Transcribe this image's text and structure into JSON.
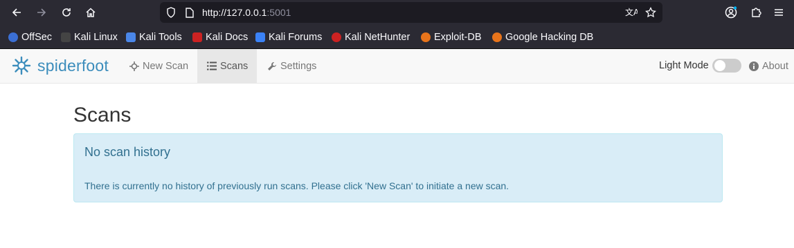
{
  "browser": {
    "url_host": "http://127.0.0.1",
    "url_port": ":5001",
    "bookmarks": [
      {
        "label": "OffSec",
        "color": "#3b6fd4"
      },
      {
        "label": "Kali Linux",
        "color": "#dddddd"
      },
      {
        "label": "Kali Tools",
        "color": "#4a86e8"
      },
      {
        "label": "Kali Docs",
        "color": "#cc2222"
      },
      {
        "label": "Kali Forums",
        "color": "#3b82f6"
      },
      {
        "label": "Kali NetHunter",
        "color": "#cc2222"
      },
      {
        "label": "Exploit-DB",
        "color": "#e8741b"
      },
      {
        "label": "Google Hacking DB",
        "color": "#e8741b"
      }
    ]
  },
  "navbar": {
    "brand_spider": "spider",
    "brand_foot": "foot",
    "items": [
      {
        "label": "New Scan",
        "icon": "crosshair-icon"
      },
      {
        "label": "Scans",
        "icon": "list-icon",
        "active": true
      },
      {
        "label": "Settings",
        "icon": "wrench-icon"
      }
    ],
    "light_mode_label": "Light Mode",
    "about_label": "About"
  },
  "main": {
    "title": "Scans",
    "alert_heading": "No scan history",
    "alert_text": "There is currently no history of previously run scans. Please click 'New Scan' to initiate a new scan."
  },
  "colors": {
    "accent": "#3c8dbc",
    "alert_bg": "#d9edf7",
    "alert_text": "#31708f"
  }
}
